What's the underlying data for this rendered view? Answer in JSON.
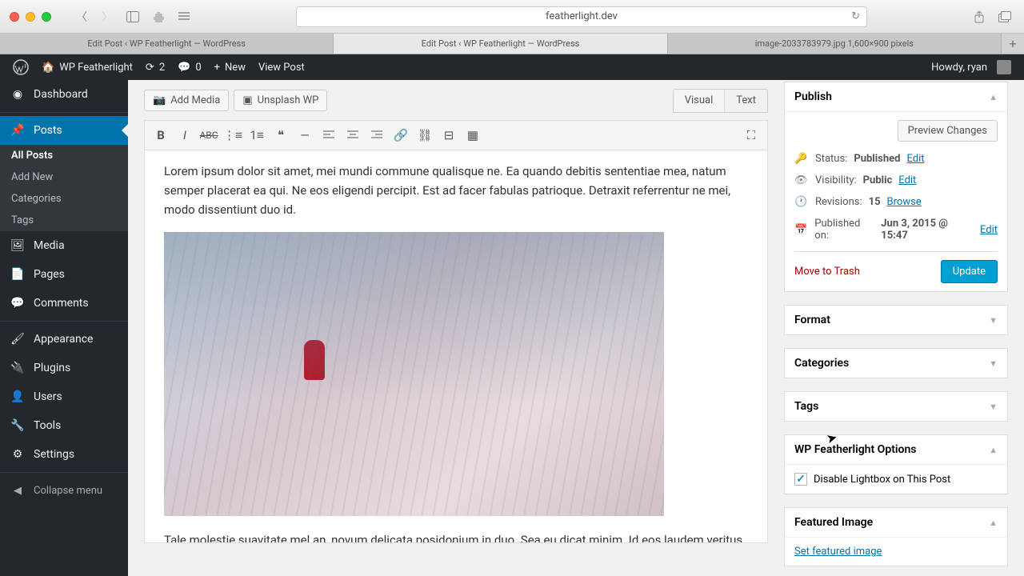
{
  "browser": {
    "url": "featherlight.dev",
    "tabs": [
      "Edit Post ‹ WP Featherlight — WordPress",
      "Edit Post ‹ WP Featherlight — WordPress",
      "image-2033783979.jpg 1,600×900 pixels"
    ]
  },
  "adminbar": {
    "site": "WP Featherlight",
    "updates": "2",
    "comments": "0",
    "new": "New",
    "view": "View Post",
    "howdy": "Howdy, ryan"
  },
  "menu": {
    "dashboard": "Dashboard",
    "posts": "Posts",
    "posts_sub": {
      "all": "All Posts",
      "add": "Add New",
      "cat": "Categories",
      "tags": "Tags"
    },
    "media": "Media",
    "pages": "Pages",
    "comments": "Comments",
    "appearance": "Appearance",
    "plugins": "Plugins",
    "users": "Users",
    "tools": "Tools",
    "settings": "Settings",
    "collapse": "Collapse menu"
  },
  "editor": {
    "add_media": "Add Media",
    "unsplash": "Unsplash WP",
    "tab_visual": "Visual",
    "tab_text": "Text",
    "para1": "Lorem ipsum dolor sit amet, mei mundi commune qualisque ne. Ea quando debitis sententiae mea, natum semper placerat ea qui. Ne eos eligendi percipit. Est ad facer fabulas patrioque. Detraxit referrentur ne mei, modo dissentiunt duo id.",
    "para2": "Tale molestie suavitate mel an, novum delicata posidonium in duo. Sea eu dicat minim. Id eos laudem veritus constituto. Ea usu mazim impetus mandamus, in mel omnis utamur atomorum."
  },
  "publish": {
    "title": "Publish",
    "preview": "Preview Changes",
    "status_label": "Status:",
    "status_value": "Published",
    "visibility_label": "Visibility:",
    "visibility_value": "Public",
    "revisions_label": "Revisions:",
    "revisions_value": "15",
    "published_label": "Published on:",
    "published_value": "Jun 3, 2015 @ 15:47",
    "edit": "Edit",
    "browse": "Browse",
    "trash": "Move to Trash",
    "update": "Update"
  },
  "boxes": {
    "format": "Format",
    "categories": "Categories",
    "tags": "Tags",
    "featherlight": "WP Featherlight Options",
    "featherlight_opt": "Disable Lightbox on This Post",
    "featured": "Featured Image",
    "featured_link": "Set featured image"
  }
}
